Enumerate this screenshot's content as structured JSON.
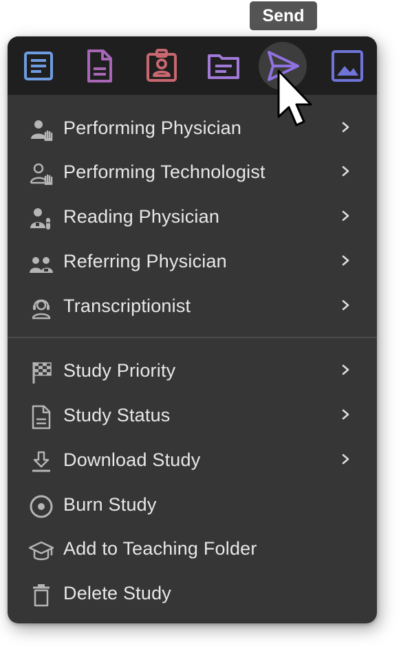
{
  "tooltip": {
    "text": "Send"
  },
  "toolbar": {
    "buttons": [
      {
        "icon": "text-document-icon",
        "color": "#6f9ce0"
      },
      {
        "icon": "report-document-icon",
        "color": "#a866b6"
      },
      {
        "icon": "id-badge-icon",
        "color": "#c8676f"
      },
      {
        "icon": "folder-icon",
        "color": "#a17ad8"
      },
      {
        "icon": "send-icon",
        "color": "#8f72e0",
        "active": true
      },
      {
        "icon": "image-icon",
        "color": "#6f74d8"
      }
    ]
  },
  "menu": {
    "group1": [
      {
        "label": "Performing Physician",
        "icon": "performing-physician-icon",
        "submenu": true
      },
      {
        "label": "Performing Technologist",
        "icon": "performing-technologist-icon",
        "submenu": true
      },
      {
        "label": "Reading Physician",
        "icon": "reading-physician-icon",
        "submenu": true
      },
      {
        "label": "Referring Physician",
        "icon": "referring-physician-icon",
        "submenu": true
      },
      {
        "label": "Transcriptionist",
        "icon": "transcriptionist-icon",
        "submenu": true
      }
    ],
    "group2": [
      {
        "label": "Study Priority",
        "icon": "checkered-flag-icon",
        "submenu": true
      },
      {
        "label": "Study Status",
        "icon": "document-icon",
        "submenu": true
      },
      {
        "label": "Download Study",
        "icon": "download-icon",
        "submenu": true
      },
      {
        "label": "Burn Study",
        "icon": "disc-icon",
        "submenu": false
      },
      {
        "label": "Add to Teaching Folder",
        "icon": "graduation-cap-icon",
        "submenu": false
      },
      {
        "label": "Delete Study",
        "icon": "trash-icon",
        "submenu": false
      }
    ]
  },
  "colors": {
    "menu_bg": "#363636",
    "toolbar_bg": "#1f1f1f",
    "text": "#e8e8e8",
    "icon_gray": "#b5b5b5"
  }
}
